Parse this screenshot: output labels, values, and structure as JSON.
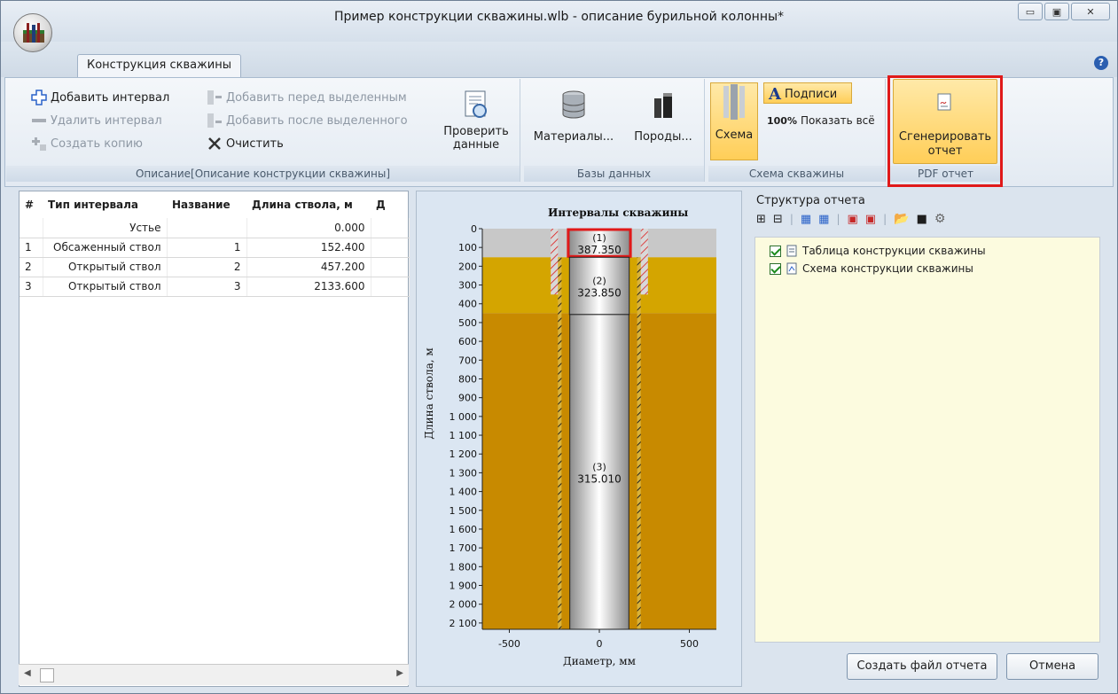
{
  "window": {
    "title": "Пример конструкции скважины.wlb - описание бурильной колонны*",
    "controls": {
      "minimize": "▭",
      "maximize": "▣",
      "close": "✕"
    }
  },
  "ribbon": {
    "tab_label": "Конструкция скважины",
    "groups": {
      "description": {
        "caption": "Описание[Описание конструкции скважины]",
        "add_interval": "Добавить интервал",
        "delete_interval": "Удалить интервал",
        "create_copy": "Создать копию",
        "add_before": "Добавить перед выделенным",
        "add_after": "Добавить после выделенного",
        "clear": "Очистить",
        "check_data": "Проверить\nданные"
      },
      "databases": {
        "caption": "Базы данных",
        "materials": "Материалы...",
        "rocks": "Породы..."
      },
      "scheme": {
        "caption": "Схема скважины",
        "scheme": "Схема",
        "labels": "Подписи",
        "show_all": "Показать всё"
      },
      "pdf": {
        "caption": "PDF отчет",
        "generate_line1": "Сгенерировать",
        "generate_line2": "отчет"
      }
    }
  },
  "grid": {
    "columns": [
      "#",
      "Тип интервала",
      "Название",
      "Длина ствола, м",
      "Д"
    ],
    "rows": [
      {
        "num": "",
        "type": "Устье",
        "name": "",
        "length": "0.000"
      },
      {
        "num": "1",
        "type": "Обсаженный ствол",
        "name": "1",
        "length": "152.400"
      },
      {
        "num": "2",
        "type": "Открытый ствол",
        "name": "2",
        "length": "457.200"
      },
      {
        "num": "3",
        "type": "Открытый ствол",
        "name": "3",
        "length": "2133.600"
      }
    ]
  },
  "chart_data": {
    "type": "well-schematic",
    "title": "Интервалы скважины",
    "xlabel": "Диаметр, мм",
    "ylabel": "Длина ствола, м",
    "xlim": [
      -650,
      650
    ],
    "ylim": [
      0,
      2133.6
    ],
    "x_ticks": [
      -500,
      0,
      500
    ],
    "y_ticks": [
      "0",
      "100",
      "200",
      "300",
      "400",
      "500",
      "600",
      "700",
      "800",
      "900",
      "1 000",
      "1 100",
      "1 200",
      "1 300",
      "1 400",
      "1 500",
      "1 600",
      "1 700",
      "1 800",
      "1 900",
      "2 000",
      "2 100"
    ],
    "y_tick_values": [
      0,
      100,
      200,
      300,
      400,
      500,
      600,
      700,
      800,
      900,
      1000,
      1100,
      1200,
      1300,
      1400,
      1500,
      1600,
      1700,
      1800,
      1900,
      2000,
      2100
    ],
    "layers": [
      {
        "from": 0,
        "to": 152.4,
        "color": "#c8c8c8"
      },
      {
        "from": 152.4,
        "to": 450,
        "color": "#d4a500"
      },
      {
        "from": 450,
        "to": 2133.6,
        "color": "#c88a00"
      }
    ],
    "intervals": [
      {
        "label": "(1)",
        "value": "387.350",
        "from": 0,
        "to": 152.4,
        "diameter": 387.35,
        "highlighted": true
      },
      {
        "label": "(2)",
        "value": "323.850",
        "from": 152.4,
        "to": 457.2,
        "diameter": 323.85
      },
      {
        "label": "(3)",
        "value": "315.010",
        "from": 457.2,
        "to": 2133.6,
        "diameter": 315.01
      }
    ]
  },
  "report": {
    "title": "Структура отчета",
    "items": [
      "Таблица конструкции скважины",
      "Схема конструкции скважины"
    ],
    "create_button": "Создать файл отчета",
    "cancel_button": "Отмена"
  }
}
